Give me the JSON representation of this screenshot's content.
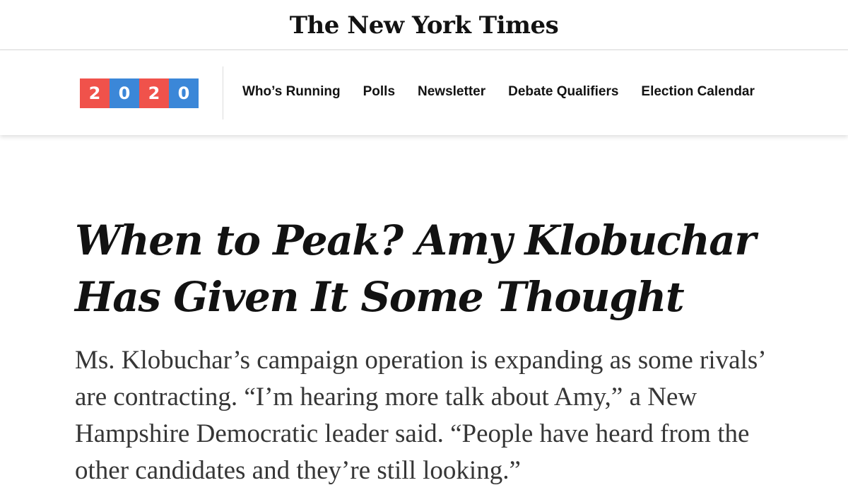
{
  "masthead": {
    "title": "The New York Times"
  },
  "badge": {
    "digits": [
      {
        "text": "2",
        "color": "#f0524b"
      },
      {
        "text": "0",
        "color": "#3b87d8"
      },
      {
        "text": "2",
        "color": "#f0524b"
      },
      {
        "text": "0",
        "color": "#3b87d8"
      }
    ]
  },
  "nav": {
    "items": [
      {
        "label": "Who’s Running"
      },
      {
        "label": "Polls"
      },
      {
        "label": "Newsletter"
      },
      {
        "label": "Debate Qualifiers"
      },
      {
        "label": "Election Calendar"
      }
    ]
  },
  "article": {
    "headline_line1": "When to Peak? Amy Klobuchar",
    "headline_line2": "Has Given It Some Thought",
    "summary": "Ms. Klobuchar’s campaign operation is expanding as some rivals’ are contracting. “I’m hearing more talk about Amy,” a New Hampshire Democratic leader said. “People have heard from the other candidates and they’re still looking.”"
  }
}
